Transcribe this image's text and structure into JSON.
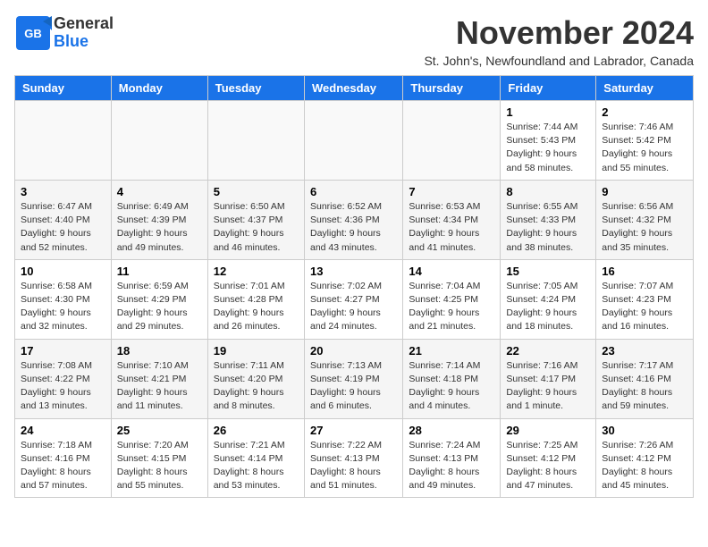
{
  "logo": {
    "general": "General",
    "blue": "Blue"
  },
  "header": {
    "month": "November 2024",
    "subtitle": "St. John's, Newfoundland and Labrador, Canada"
  },
  "days_of_week": [
    "Sunday",
    "Monday",
    "Tuesday",
    "Wednesday",
    "Thursday",
    "Friday",
    "Saturday"
  ],
  "weeks": [
    {
      "days": [
        {
          "num": "",
          "info": ""
        },
        {
          "num": "",
          "info": ""
        },
        {
          "num": "",
          "info": ""
        },
        {
          "num": "",
          "info": ""
        },
        {
          "num": "",
          "info": ""
        },
        {
          "num": "1",
          "info": "Sunrise: 7:44 AM\nSunset: 5:43 PM\nDaylight: 9 hours and 58 minutes."
        },
        {
          "num": "2",
          "info": "Sunrise: 7:46 AM\nSunset: 5:42 PM\nDaylight: 9 hours and 55 minutes."
        }
      ]
    },
    {
      "days": [
        {
          "num": "3",
          "info": "Sunrise: 6:47 AM\nSunset: 4:40 PM\nDaylight: 9 hours and 52 minutes."
        },
        {
          "num": "4",
          "info": "Sunrise: 6:49 AM\nSunset: 4:39 PM\nDaylight: 9 hours and 49 minutes."
        },
        {
          "num": "5",
          "info": "Sunrise: 6:50 AM\nSunset: 4:37 PM\nDaylight: 9 hours and 46 minutes."
        },
        {
          "num": "6",
          "info": "Sunrise: 6:52 AM\nSunset: 4:36 PM\nDaylight: 9 hours and 43 minutes."
        },
        {
          "num": "7",
          "info": "Sunrise: 6:53 AM\nSunset: 4:34 PM\nDaylight: 9 hours and 41 minutes."
        },
        {
          "num": "8",
          "info": "Sunrise: 6:55 AM\nSunset: 4:33 PM\nDaylight: 9 hours and 38 minutes."
        },
        {
          "num": "9",
          "info": "Sunrise: 6:56 AM\nSunset: 4:32 PM\nDaylight: 9 hours and 35 minutes."
        }
      ]
    },
    {
      "days": [
        {
          "num": "10",
          "info": "Sunrise: 6:58 AM\nSunset: 4:30 PM\nDaylight: 9 hours and 32 minutes."
        },
        {
          "num": "11",
          "info": "Sunrise: 6:59 AM\nSunset: 4:29 PM\nDaylight: 9 hours and 29 minutes."
        },
        {
          "num": "12",
          "info": "Sunrise: 7:01 AM\nSunset: 4:28 PM\nDaylight: 9 hours and 26 minutes."
        },
        {
          "num": "13",
          "info": "Sunrise: 7:02 AM\nSunset: 4:27 PM\nDaylight: 9 hours and 24 minutes."
        },
        {
          "num": "14",
          "info": "Sunrise: 7:04 AM\nSunset: 4:25 PM\nDaylight: 9 hours and 21 minutes."
        },
        {
          "num": "15",
          "info": "Sunrise: 7:05 AM\nSunset: 4:24 PM\nDaylight: 9 hours and 18 minutes."
        },
        {
          "num": "16",
          "info": "Sunrise: 7:07 AM\nSunset: 4:23 PM\nDaylight: 9 hours and 16 minutes."
        }
      ]
    },
    {
      "days": [
        {
          "num": "17",
          "info": "Sunrise: 7:08 AM\nSunset: 4:22 PM\nDaylight: 9 hours and 13 minutes."
        },
        {
          "num": "18",
          "info": "Sunrise: 7:10 AM\nSunset: 4:21 PM\nDaylight: 9 hours and 11 minutes."
        },
        {
          "num": "19",
          "info": "Sunrise: 7:11 AM\nSunset: 4:20 PM\nDaylight: 9 hours and 8 minutes."
        },
        {
          "num": "20",
          "info": "Sunrise: 7:13 AM\nSunset: 4:19 PM\nDaylight: 9 hours and 6 minutes."
        },
        {
          "num": "21",
          "info": "Sunrise: 7:14 AM\nSunset: 4:18 PM\nDaylight: 9 hours and 4 minutes."
        },
        {
          "num": "22",
          "info": "Sunrise: 7:16 AM\nSunset: 4:17 PM\nDaylight: 9 hours and 1 minute."
        },
        {
          "num": "23",
          "info": "Sunrise: 7:17 AM\nSunset: 4:16 PM\nDaylight: 8 hours and 59 minutes."
        }
      ]
    },
    {
      "days": [
        {
          "num": "24",
          "info": "Sunrise: 7:18 AM\nSunset: 4:16 PM\nDaylight: 8 hours and 57 minutes."
        },
        {
          "num": "25",
          "info": "Sunrise: 7:20 AM\nSunset: 4:15 PM\nDaylight: 8 hours and 55 minutes."
        },
        {
          "num": "26",
          "info": "Sunrise: 7:21 AM\nSunset: 4:14 PM\nDaylight: 8 hours and 53 minutes."
        },
        {
          "num": "27",
          "info": "Sunrise: 7:22 AM\nSunset: 4:13 PM\nDaylight: 8 hours and 51 minutes."
        },
        {
          "num": "28",
          "info": "Sunrise: 7:24 AM\nSunset: 4:13 PM\nDaylight: 8 hours and 49 minutes."
        },
        {
          "num": "29",
          "info": "Sunrise: 7:25 AM\nSunset: 4:12 PM\nDaylight: 8 hours and 47 minutes."
        },
        {
          "num": "30",
          "info": "Sunrise: 7:26 AM\nSunset: 4:12 PM\nDaylight: 8 hours and 45 minutes."
        }
      ]
    }
  ]
}
